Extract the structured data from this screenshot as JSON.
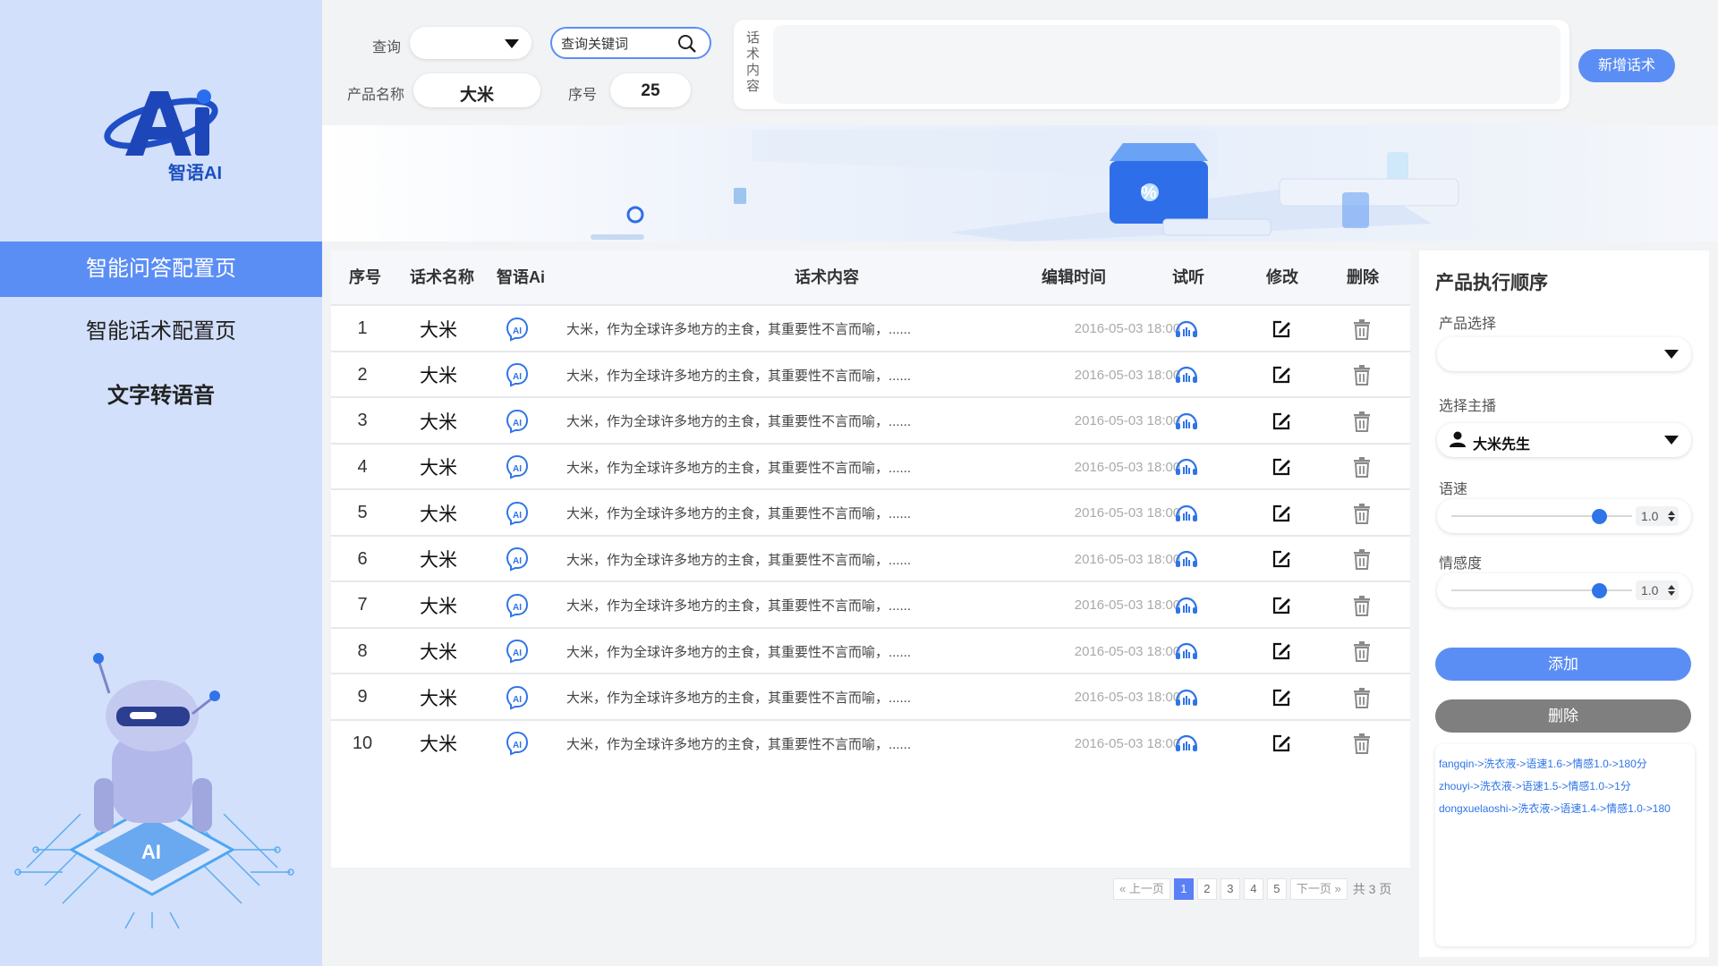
{
  "brand": {
    "logo_text": "智语AI"
  },
  "nav": [
    {
      "label": "智能问答配置页"
    },
    {
      "label": "智能话术配置页"
    },
    {
      "label": "文字转语音"
    }
  ],
  "filters": {
    "query_label": "查询",
    "query_value": "",
    "search_placeholder": "查询关键词",
    "product_label": "产品名称",
    "product_value": "大米",
    "seq_label": "序号",
    "seq_value": "25",
    "script_label": "话术内容",
    "script_value": "",
    "add_script_button": "新增话术"
  },
  "table": {
    "headers": [
      "序号",
      "话术名称",
      "智语Ai",
      "话术内容",
      "编辑时间",
      "试听",
      "修改",
      "删除"
    ],
    "rows": [
      {
        "idx": "1",
        "name": "大米",
        "content": "大米，作为全球许多地方的主食，其重要性不言而喻，......",
        "time": "2016-05-03 18:00"
      },
      {
        "idx": "2",
        "name": "大米",
        "content": "大米，作为全球许多地方的主食，其重要性不言而喻，......",
        "time": "2016-05-03 18:00"
      },
      {
        "idx": "3",
        "name": "大米",
        "content": "大米，作为全球许多地方的主食，其重要性不言而喻，......",
        "time": "2016-05-03 18:00"
      },
      {
        "idx": "4",
        "name": "大米",
        "content": "大米，作为全球许多地方的主食，其重要性不言而喻，......",
        "time": "2016-05-03 18:00"
      },
      {
        "idx": "5",
        "name": "大米",
        "content": "大米，作为全球许多地方的主食，其重要性不言而喻，......",
        "time": "2016-05-03 18:00"
      },
      {
        "idx": "6",
        "name": "大米",
        "content": "大米，作为全球许多地方的主食，其重要性不言而喻，......",
        "time": "2016-05-03 18:00"
      },
      {
        "idx": "7",
        "name": "大米",
        "content": "大米，作为全球许多地方的主食，其重要性不言而喻，......",
        "time": "2016-05-03 18:00"
      },
      {
        "idx": "8",
        "name": "大米",
        "content": "大米，作为全球许多地方的主食，其重要性不言而喻，......",
        "time": "2016-05-03 18:00"
      },
      {
        "idx": "9",
        "name": "大米",
        "content": "大米，作为全球许多地方的主食，其重要性不言而喻，......",
        "time": "2016-05-03 18:00"
      },
      {
        "idx": "10",
        "name": "大米",
        "content": "大米，作为全球许多地方的主食，其重要性不言而喻，......",
        "time": "2016-05-03 18:00"
      }
    ]
  },
  "pagination": {
    "prev": "« 上一页",
    "pages": [
      "1",
      "2",
      "3",
      "4",
      "5"
    ],
    "current": "1",
    "next": "下一页 »",
    "total": "共 3 页"
  },
  "right_panel": {
    "title": "产品执行顺序",
    "product_select_label": "产品选择",
    "product_select_value": "",
    "anchor_label": "选择主播",
    "anchor_value": "大米先生",
    "speed_label": "语速",
    "speed_value": "1.0",
    "speed_level": 0.87,
    "emotion_label": "情感度",
    "emotion_value": "1.0",
    "emotion_level": 0.87,
    "add_button": "添加",
    "delete_button": "删除",
    "log": [
      "fangqin->洗衣液->语速1.6->情感1.0->180分",
      "zhouyi->洗衣液->语速1.5->情感1.0->1分",
      "dongxuelaoshi->洗衣液->语速1.4->情感1.0->180"
    ]
  },
  "colors": {
    "accent": "#5b8ef5",
    "sidebar_bg": "#d3e0fb",
    "gray_button": "#7f7f7f",
    "link_blue": "#2f74e8"
  }
}
